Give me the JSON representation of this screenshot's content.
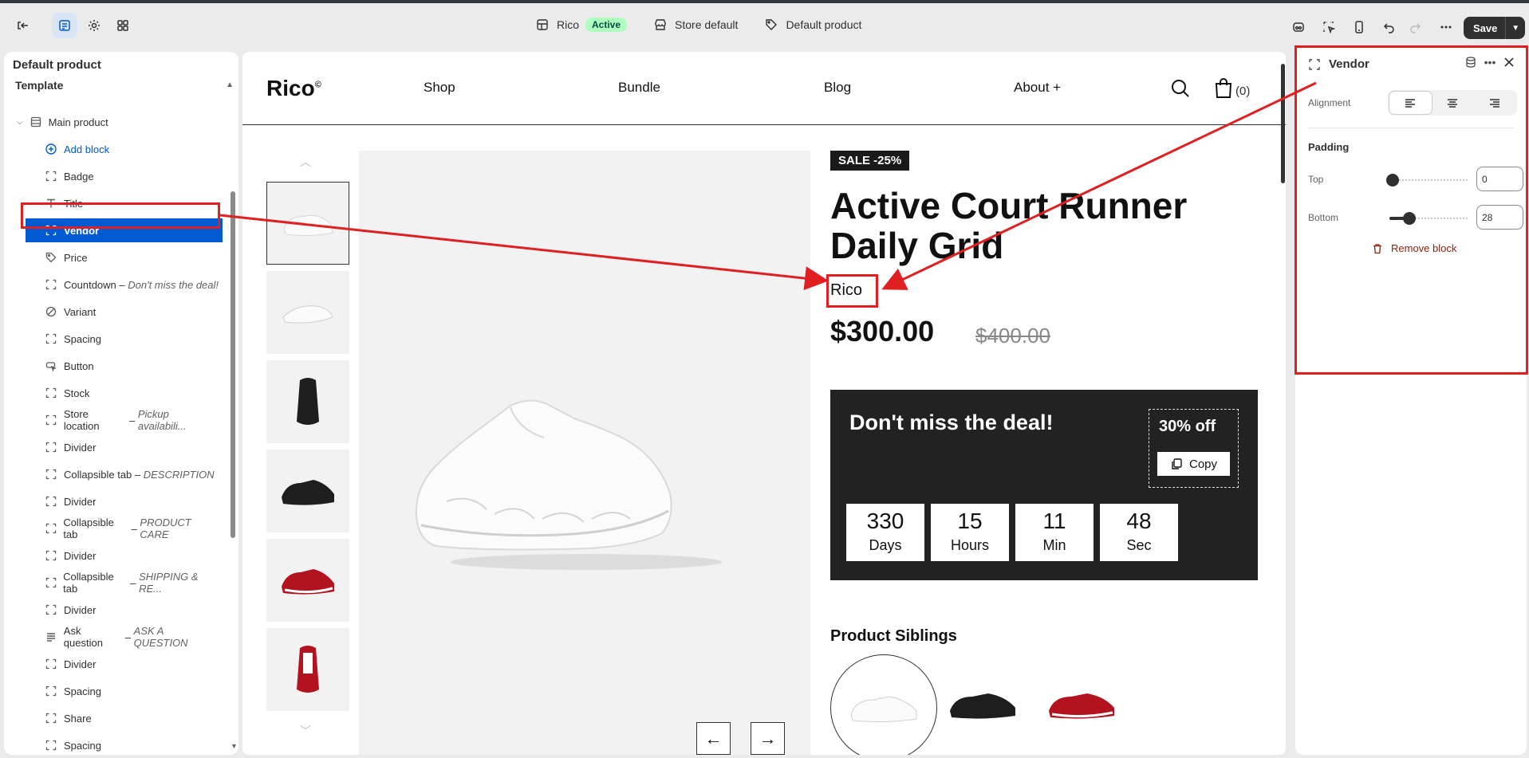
{
  "topbar": {
    "theme_name": "Rico",
    "theme_status": "Active",
    "store": "Store default",
    "template": "Default product",
    "save_label": "Save",
    "icons": [
      "exit-icon",
      "sections-icon",
      "settings-icon",
      "apps-icon",
      "inspect-icon",
      "select-icon",
      "mobile-icon",
      "undo-icon",
      "redo-icon",
      "more-icon"
    ]
  },
  "left_panel": {
    "title": "Default product",
    "section_label": "Template",
    "main_item": "Main product",
    "add_block": "Add block",
    "blocks": [
      {
        "label": "Badge",
        "sub": "",
        "icon": "block-icon"
      },
      {
        "label": "Title",
        "sub": "",
        "icon": "text-icon"
      },
      {
        "label": "Vendor",
        "sub": "",
        "icon": "block-icon",
        "selected": true
      },
      {
        "label": "Price",
        "sub": "",
        "icon": "tag-icon"
      },
      {
        "label": "Countdown",
        "sub": "Don't miss the deal!",
        "icon": "block-icon"
      },
      {
        "label": "Variant",
        "sub": "",
        "icon": "variant-icon"
      },
      {
        "label": "Spacing",
        "sub": "",
        "icon": "block-icon"
      },
      {
        "label": "Button",
        "sub": "",
        "icon": "button-icon"
      },
      {
        "label": "Stock",
        "sub": "",
        "icon": "block-icon"
      },
      {
        "label": "Store location",
        "sub": "Pickup availabili...",
        "icon": "block-icon"
      },
      {
        "label": "Divider",
        "sub": "",
        "icon": "block-icon"
      },
      {
        "label": "Collapsible tab",
        "sub": "DESCRIPTION",
        "icon": "block-icon"
      },
      {
        "label": "Divider",
        "sub": "",
        "icon": "block-icon"
      },
      {
        "label": "Collapsible tab",
        "sub": "PRODUCT CARE",
        "icon": "block-icon"
      },
      {
        "label": "Divider",
        "sub": "",
        "icon": "block-icon"
      },
      {
        "label": "Collapsible tab",
        "sub": "SHIPPING & RE...",
        "icon": "block-icon"
      },
      {
        "label": "Divider",
        "sub": "",
        "icon": "block-icon"
      },
      {
        "label": "Ask question",
        "sub": "ASK A QUESTION",
        "icon": "lines-icon"
      },
      {
        "label": "Divider",
        "sub": "",
        "icon": "block-icon"
      },
      {
        "label": "Spacing",
        "sub": "",
        "icon": "block-icon"
      },
      {
        "label": "Share",
        "sub": "",
        "icon": "block-icon"
      },
      {
        "label": "Spacing",
        "sub": "",
        "icon": "block-icon"
      }
    ]
  },
  "preview": {
    "logo": "Rico",
    "logo_mark": "©",
    "nav": [
      "Shop",
      "Bundle",
      "Blog",
      "About +"
    ],
    "cart_count": "(0)",
    "sale_badge": "SALE -25%",
    "product_title": "Active Court Runner Daily Grid",
    "vendor": "Rico",
    "price": "$300.00",
    "compare_price": "$400.00",
    "deal": {
      "title": "Don't miss the deal!",
      "discount": "30% off",
      "copy_label": "Copy",
      "countdown": [
        {
          "value": "330",
          "unit": "Days"
        },
        {
          "value": "15",
          "unit": "Hours"
        },
        {
          "value": "11",
          "unit": "Min"
        },
        {
          "value": "48",
          "unit": "Sec"
        }
      ]
    },
    "siblings_title": "Product Siblings",
    "arrow_prev": "←",
    "arrow_next": "→",
    "colors": {
      "shoe_white": "#f4f4f4",
      "shoe_black": "#1e1e1e",
      "shoe_red": "#b3121f"
    }
  },
  "right_panel": {
    "title": "Vendor",
    "alignment_label": "Alignment",
    "padding_label": "Padding",
    "top_label": "Top",
    "top_value": "0",
    "bottom_label": "Bottom",
    "bottom_value": "28",
    "remove_label": "Remove block"
  },
  "accent": {
    "selected": "#005bd3",
    "annotation": "#e02020"
  }
}
